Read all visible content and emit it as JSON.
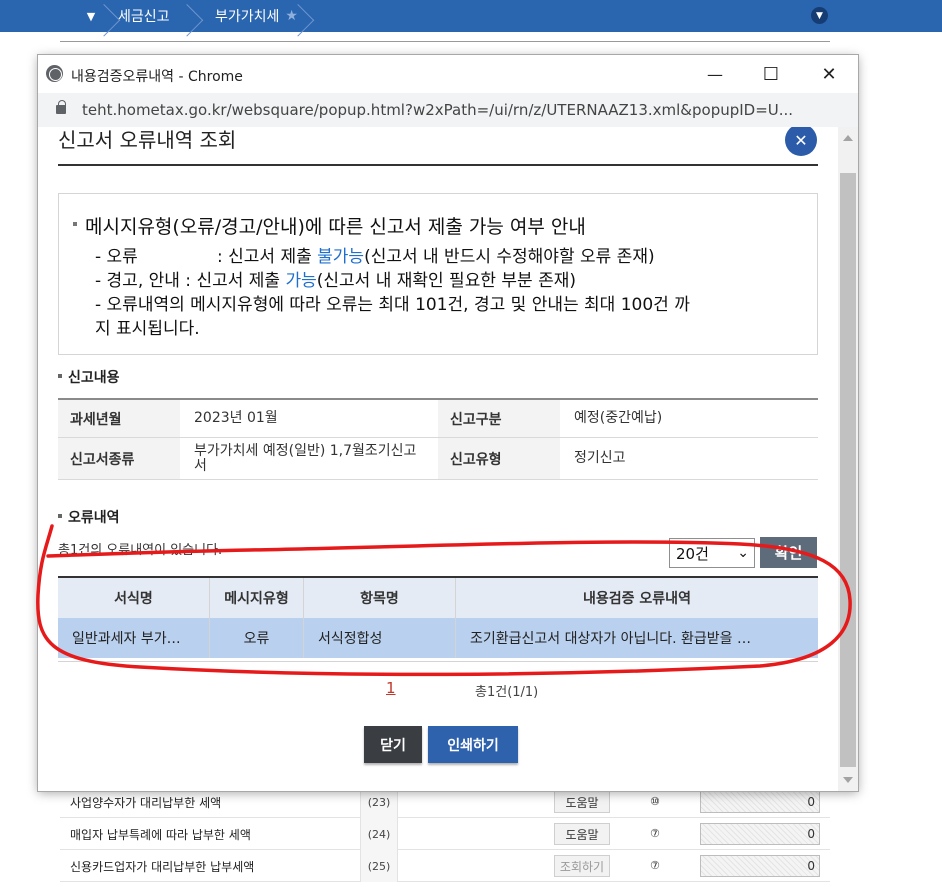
{
  "nav": {
    "dropdown_icon": "caret-down",
    "crumbs": [
      "세금신고",
      "부가가치세"
    ],
    "star_icon": "star",
    "menu_toggle_icon": "chevron-down"
  },
  "background_rows": [
    {
      "label": "사업양수자가 대리납부한 세액",
      "num": "(23)",
      "button": "도움말",
      "mark": "⑩",
      "amount": "0"
    },
    {
      "label": "매입자 납부특례에 따라 납부한 세액",
      "num": "(24)",
      "button": "도움말",
      "mark": "⑦",
      "amount": "0"
    },
    {
      "label": "신용카드업자가 대리납부한 납부세액",
      "num": "(25)",
      "button": "조회하기",
      "mark": "⑦",
      "amount": "0"
    }
  ],
  "window": {
    "title": "내용검증오류내역 - Chrome",
    "url": "teht.hometax.go.kr/websquare/popup.html?w2xPath=/ui/rn/z/UTERNAAZ13.xml&popupID=U...",
    "minimize": "—",
    "maximize": "☐",
    "close": "✕"
  },
  "popup": {
    "title": "신고서 오류내역 조회",
    "close_icon": "✕",
    "info": {
      "main": "메시지유형(오류/경고/안내)에 따른 신고서 제출 가능 여부 안내",
      "line1_prefix": "- 오류",
      "line1_mid": ": 신고서 제출 ",
      "line1_em": "불가능",
      "line1_suffix": "(신고서 내 반드시 수정해야할 오류 존재)",
      "line2_prefix": "- 경고, 안내 : 신고서 제출 ",
      "line2_em": "가능",
      "line2_suffix": "(신고서 내 재확인 필요한 부분 존재)",
      "line3": "- 오류내역의 메시지유형에 따라 오류는 최대 101건, 경고 및 안내는 최대 100건 까",
      "line4": "지 표시됩니다."
    },
    "report_section": {
      "title": "신고내용",
      "rows": [
        {
          "h1": "과세년월",
          "v1": "2023년 01월",
          "h2": "신고구분",
          "v2": "예정(중간예납)"
        },
        {
          "h1": "신고서종류",
          "v1": "부가가치세 예정(일반) 1,7월조기신고서",
          "h2": "신고유형",
          "v2": "정기신고"
        }
      ]
    },
    "error_section": {
      "title": "오류내역",
      "count_text": "총1건의 오류내역이 있습니다.",
      "page_size": "20건",
      "confirm_label": "확인",
      "columns": [
        "서식명",
        "메시지유형",
        "항목명",
        "내용검증 오류내역"
      ],
      "rows": [
        [
          "일반과세자 부가…",
          "오류",
          "서식정합성",
          "조기환급신고서 대상자가 아닙니다. 환급받을 …"
        ]
      ]
    },
    "pagination": {
      "page": "1",
      "summary": "총1건(1/1)"
    },
    "buttons": {
      "close": "닫기",
      "print": "인쇄하기"
    }
  }
}
